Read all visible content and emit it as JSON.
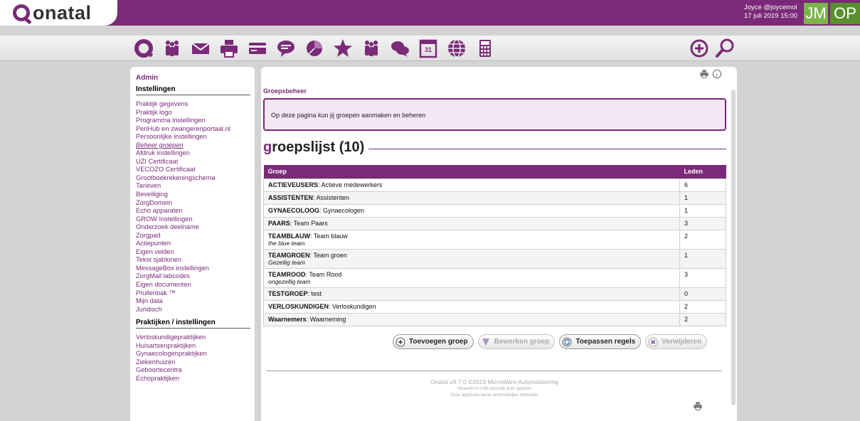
{
  "brand": {
    "logo_text": "onatal",
    "accent_color": "#7a2a78"
  },
  "user": {
    "name": "Joyce @joycemol",
    "datetime": "17 juli 2019 15:00",
    "initials": "JM",
    "practice_initials": "OP"
  },
  "toolbar": {
    "icons": [
      "onatal-home-icon",
      "people-icon",
      "mail-icon",
      "print-icon",
      "card-icon",
      "chat-bubble-icon",
      "pie-chart-icon",
      "star-icon",
      "group-icon",
      "messages-icon",
      "calendar-icon",
      "globe-icon",
      "calculator-icon"
    ],
    "right_icons": [
      "add-icon",
      "search-icon"
    ]
  },
  "sidebar": {
    "admin_label": "Admin",
    "heading_1": "Instellingen",
    "items": [
      "Praktijk gegevens",
      "Praktijk logo",
      "Programma instellingen",
      "PeriHub en zwangerenportaal.nl",
      "Persoonlijke instellingen",
      "Beheer groepen",
      "Afdruk instellingen",
      "UZI Certificaat",
      "VECOZO Certificaat",
      "Grootboekrekeningschema",
      "Tarieven",
      "Beveiliging",
      "ZorgDomein",
      "Echo apparaten",
      "GROW Instellingen",
      "Onderzoek deelname",
      "Zorgpad",
      "Actiepunten",
      "Eigen velden",
      "Tekst sjablonen",
      "MessageBox instellingen",
      "ZorgMail labcodes",
      "Eigen documenten",
      "Prullenbak ™",
      "Mijn data",
      "Juridisch"
    ],
    "active_item": "Beheer groepen",
    "heading_2": "Praktijken / instellingen",
    "items_2": [
      "Verloskundigepraktijken",
      "Huisartsenpraktijken",
      "Gynaecologenpraktijken",
      "Ziekenhuizen",
      "Geboortecentra",
      "Echopraktijken"
    ]
  },
  "main": {
    "title": "Groepsbeheer",
    "info": "Op deze pagina kun jij groepen aanmaken en beheren",
    "heading_first": "g",
    "heading_rest": "roepslijst (10)",
    "table": {
      "headers": [
        "Groep",
        "Leden"
      ],
      "rows": [
        {
          "code": "ACTIEVEUSERS",
          "name": ": Actieve medewerkers",
          "desc": "",
          "leden": "6"
        },
        {
          "code": "ASSISTENTEN",
          "name": ": Assistenten",
          "desc": "",
          "leden": "1"
        },
        {
          "code": "GYNAECOLOOG",
          "name": ": Gynaecologen",
          "desc": "",
          "leden": "1"
        },
        {
          "code": "PAARS",
          "name": ": Team Paars",
          "desc": "",
          "leden": "3"
        },
        {
          "code": "TEAMBLAUW",
          "name": ": Team blauw",
          "desc": "the blue team",
          "leden": "2"
        },
        {
          "code": "TEAMGROEN",
          "name": ": Team groen",
          "desc": "Gezellig team",
          "leden": "1"
        },
        {
          "code": "TEAMROOD",
          "name": ": Team Rood",
          "desc": "ongezellig team",
          "leden": "3"
        },
        {
          "code": "TESTGROEP",
          "name": ": test",
          "desc": "",
          "leden": "0"
        },
        {
          "code": "VERLOSKUNDIGEN",
          "name": ": Verloskundigen",
          "desc": "",
          "leden": "2"
        },
        {
          "code": "Waarnemers",
          "name": ": Waarneming",
          "desc": "",
          "leden": "2"
        }
      ]
    },
    "buttons": {
      "add": "Toevoegen groep",
      "edit": "Bewerken groep",
      "apply": "Toepassen regels",
      "delete": "Verwijderen"
    },
    "footer": {
      "version": "Onatal v9.7.0 ©2019 MicroWare Automatisering",
      "timing": "Verwerkt in 0.66 seconde door app4lon",
      "notice": "Deze applicatie bevat vertrouwelijke informatie"
    }
  }
}
